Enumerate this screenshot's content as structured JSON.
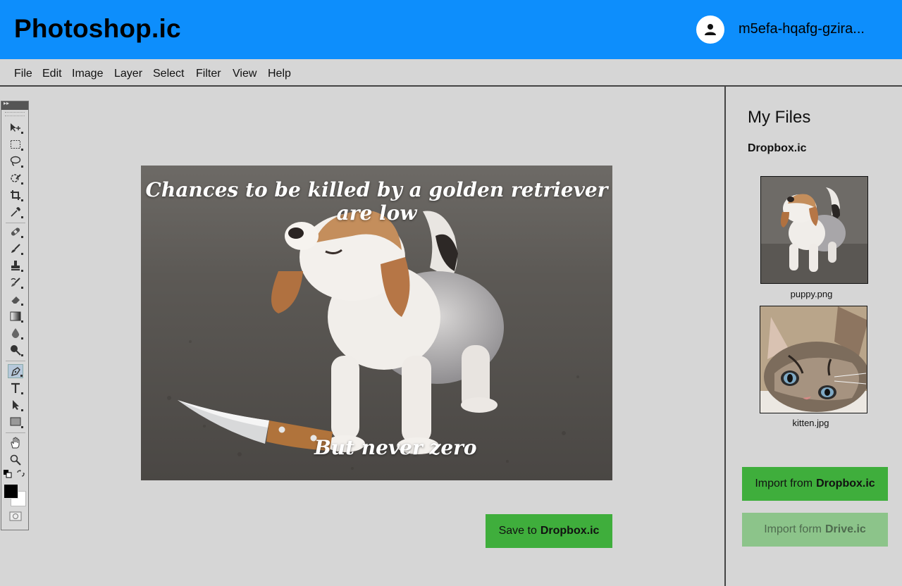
{
  "app": {
    "title": "Photoshop.ic",
    "username": "m5efa-hqafg-gzira..."
  },
  "menu": [
    "File",
    "Edit",
    "Image",
    "Layer",
    "Select",
    "Filter",
    "View",
    "Help"
  ],
  "canvas": {
    "caption_top": "Chances to be killed by a golden retriever are low",
    "caption_bottom": "But never zero"
  },
  "save_button": {
    "prefix": "Save to",
    "service": "Dropbox.ic"
  },
  "panel": {
    "title": "My Files",
    "source": "Dropbox.ic",
    "files": [
      {
        "name": "puppy.png",
        "icon": "puppy-image"
      },
      {
        "name": "kitten.jpg",
        "icon": "kitten-image"
      }
    ],
    "import_dropbox": {
      "prefix": "Import from",
      "service": "Dropbox.ic"
    },
    "import_drive": {
      "prefix": "Import form",
      "service": "Drive.ic"
    }
  },
  "colors": {
    "header": "#0d8efc",
    "button": "#3fae3c",
    "button_disabled": "#8cc48a"
  }
}
